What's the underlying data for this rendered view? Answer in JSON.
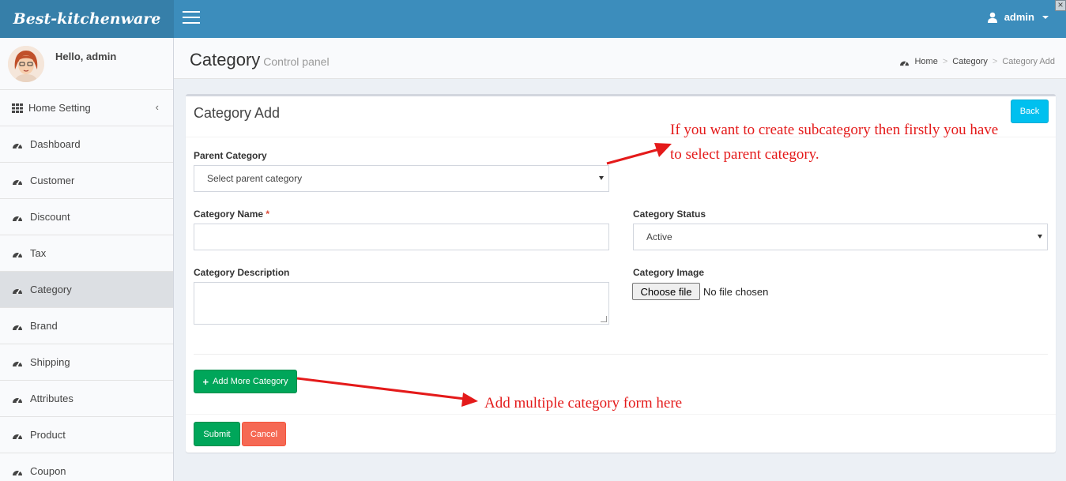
{
  "header": {
    "logo": "Best-kitchenware",
    "user_name": "admin"
  },
  "sidebar": {
    "greeting": "Hello, admin",
    "items": [
      {
        "label": "Home Setting",
        "icon": "grid-icon"
      },
      {
        "label": "Dashboard",
        "icon": "dashboard-icon"
      },
      {
        "label": "Customer",
        "icon": "dashboard-icon"
      },
      {
        "label": "Discount",
        "icon": "dashboard-icon"
      },
      {
        "label": "Tax",
        "icon": "dashboard-icon"
      },
      {
        "label": "Category",
        "icon": "dashboard-icon",
        "active": true
      },
      {
        "label": "Brand",
        "icon": "dashboard-icon"
      },
      {
        "label": "Shipping",
        "icon": "dashboard-icon"
      },
      {
        "label": "Attributes",
        "icon": "dashboard-icon"
      },
      {
        "label": "Product",
        "icon": "dashboard-icon"
      },
      {
        "label": "Coupon",
        "icon": "dashboard-icon"
      }
    ]
  },
  "content_header": {
    "title": "Category",
    "subtitle": "Control panel",
    "breadcrumb": [
      "Home",
      "Category",
      "Category Add"
    ]
  },
  "box": {
    "title": "Category Add",
    "back_label": "Back"
  },
  "form": {
    "parent_category_label": "Parent Category",
    "parent_category_value": "Select parent category",
    "name_label": "Category Name",
    "name_required": "*",
    "name_value": "",
    "status_label": "Category Status",
    "status_value": "Active",
    "description_label": "Category Description",
    "description_value": "",
    "image_label": "Category Image",
    "file_button": "Choose file",
    "file_status": "No file chosen",
    "add_more_label": "Add More Category",
    "submit_label": "Submit",
    "cancel_label": "Cancel"
  },
  "annotations": {
    "note1_line1": "If you want to create subcategory then firstly you have",
    "note1_line2": "to select parent category.",
    "note2": "Add multiple category form here"
  },
  "colors": {
    "header": "#3c8dbc",
    "logo_bg": "#367fa9",
    "success": "#00a65a",
    "danger": "#f56954",
    "info": "#00c0ef",
    "annotation": "#e41a1a"
  }
}
